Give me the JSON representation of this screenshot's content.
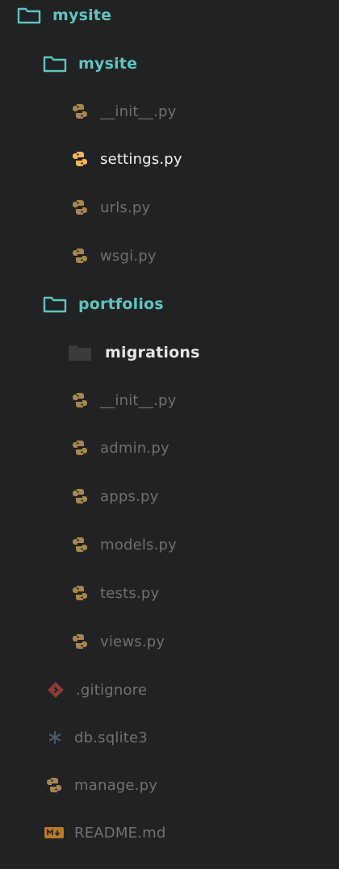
{
  "tree": {
    "root": {
      "label": "mysite",
      "children": {
        "mysite_folder": {
          "label": "mysite",
          "files": {
            "init": "__init__.py",
            "settings": "settings.py",
            "urls": "urls.py",
            "wsgi": "wsgi.py"
          }
        },
        "portfolios_folder": {
          "label": "portfolios",
          "migrations": "migrations",
          "files": {
            "init": "__init__.py",
            "admin": "admin.py",
            "apps": "apps.py",
            "models": "models.py",
            "tests": "tests.py",
            "views": "views.py"
          }
        },
        "root_files": {
          "gitignore": ".gitignore",
          "db": "db.sqlite3",
          "manage": "manage.py",
          "readme": "README.md"
        }
      }
    }
  },
  "colors": {
    "background": "#212223",
    "folder_accent": "#5fc4c1",
    "python_icon": "#c7964a",
    "python_icon_active": "#f0b45e",
    "git_icon": "#a0403a",
    "readme_icon": "#c98a33"
  },
  "icons": {
    "folder": "folder-outline-icon",
    "folder_closed": "folder-closed-icon",
    "python": "python-icon",
    "git": "git-icon",
    "database": "asterisk-icon",
    "markdown": "markdown-icon"
  }
}
